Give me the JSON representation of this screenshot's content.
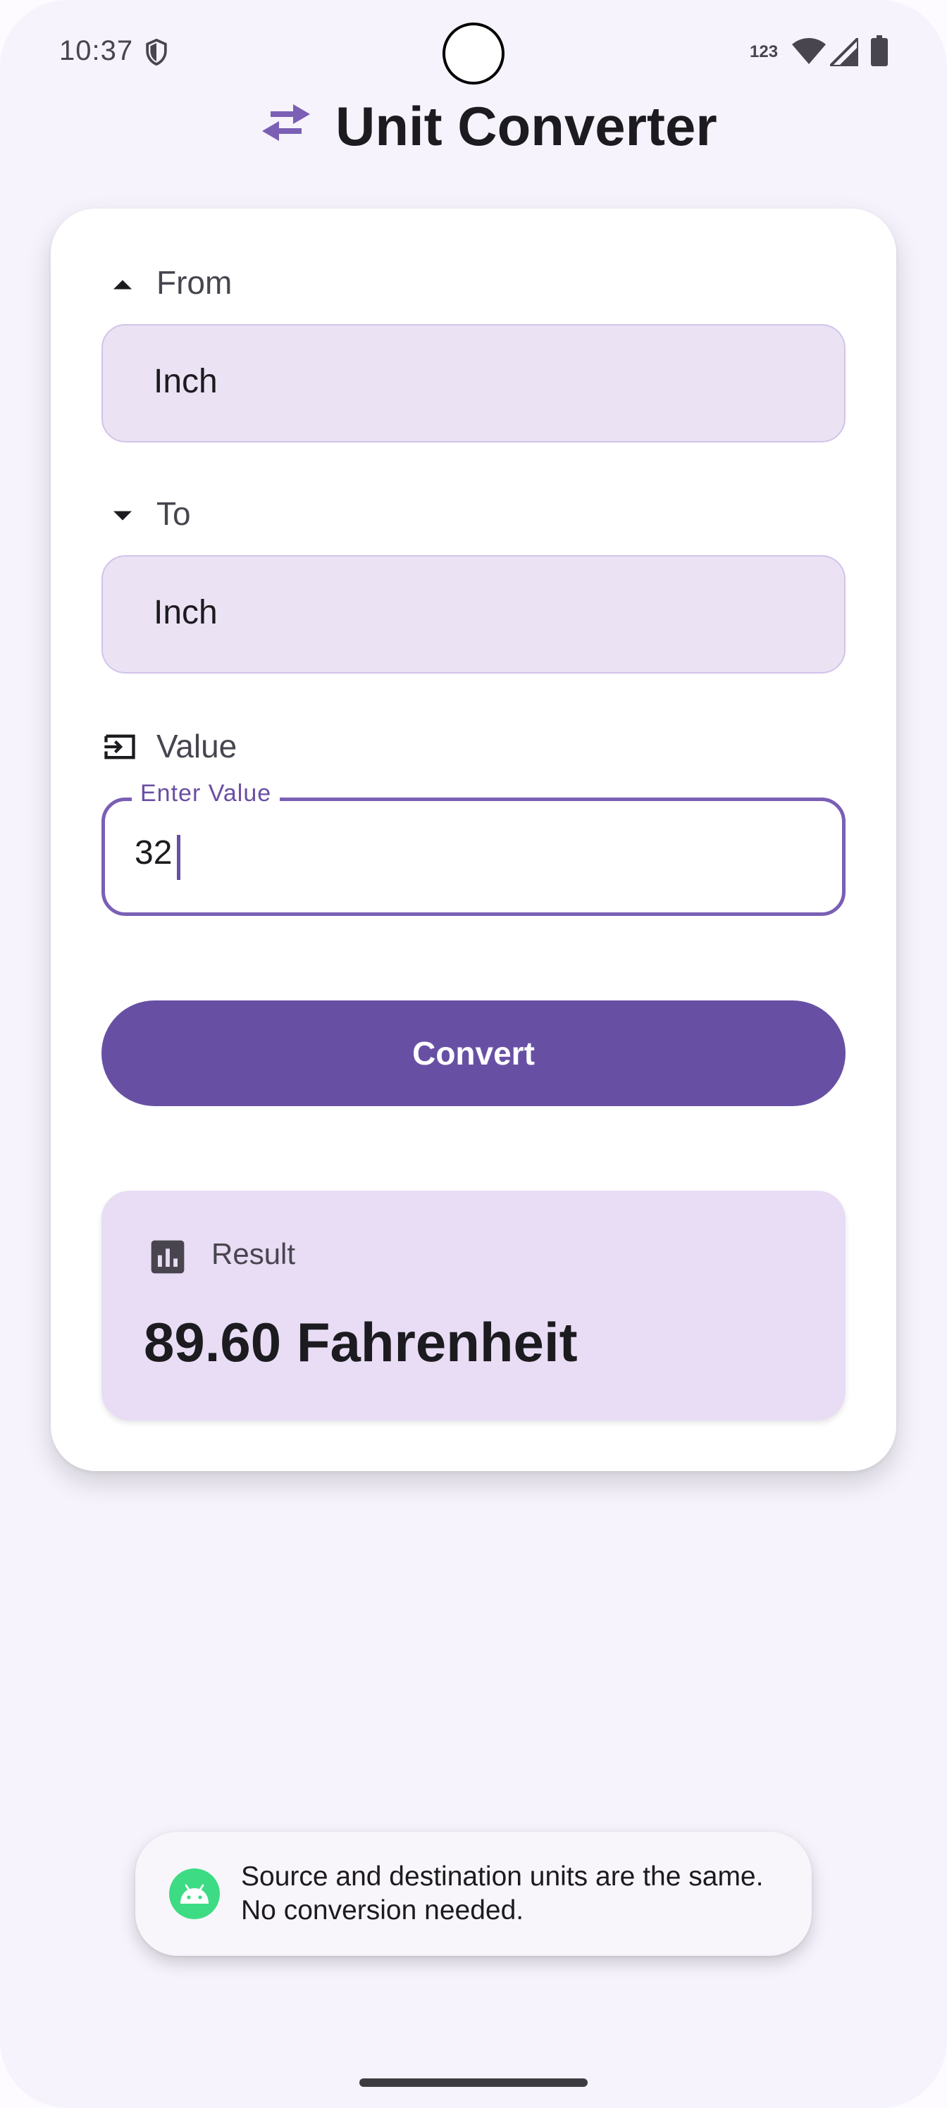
{
  "status_bar": {
    "time": "10:37",
    "network_label": "123",
    "icons": [
      "shield-icon",
      "wifi-icon",
      "signal-icon",
      "battery-icon"
    ]
  },
  "header": {
    "title": "Unit Converter",
    "icon": "swap-horiz-icon"
  },
  "from": {
    "label": "From",
    "icon": "arrow-drop-up-icon",
    "selected": "Inch"
  },
  "to": {
    "label": "To",
    "icon": "arrow-drop-down-icon",
    "selected": "Inch"
  },
  "value": {
    "label": "Value",
    "icon": "input-icon",
    "field_label": "Enter Value",
    "current": "32"
  },
  "convert_button": {
    "label": "Convert"
  },
  "result": {
    "label": "Result",
    "icon": "bar-chart-icon",
    "value": "89.60 Fahrenheit"
  },
  "toast": {
    "icon": "android-icon",
    "message": "Source and destination units are the same. No conversion needed."
  },
  "colors": {
    "primary": "#6750a4",
    "background": "#f6f3fc",
    "surface": "#ffffff",
    "select_fill": "#ebe2f4",
    "result_fill": "#e8ddf5",
    "toast_icon": "#3ddc84"
  }
}
